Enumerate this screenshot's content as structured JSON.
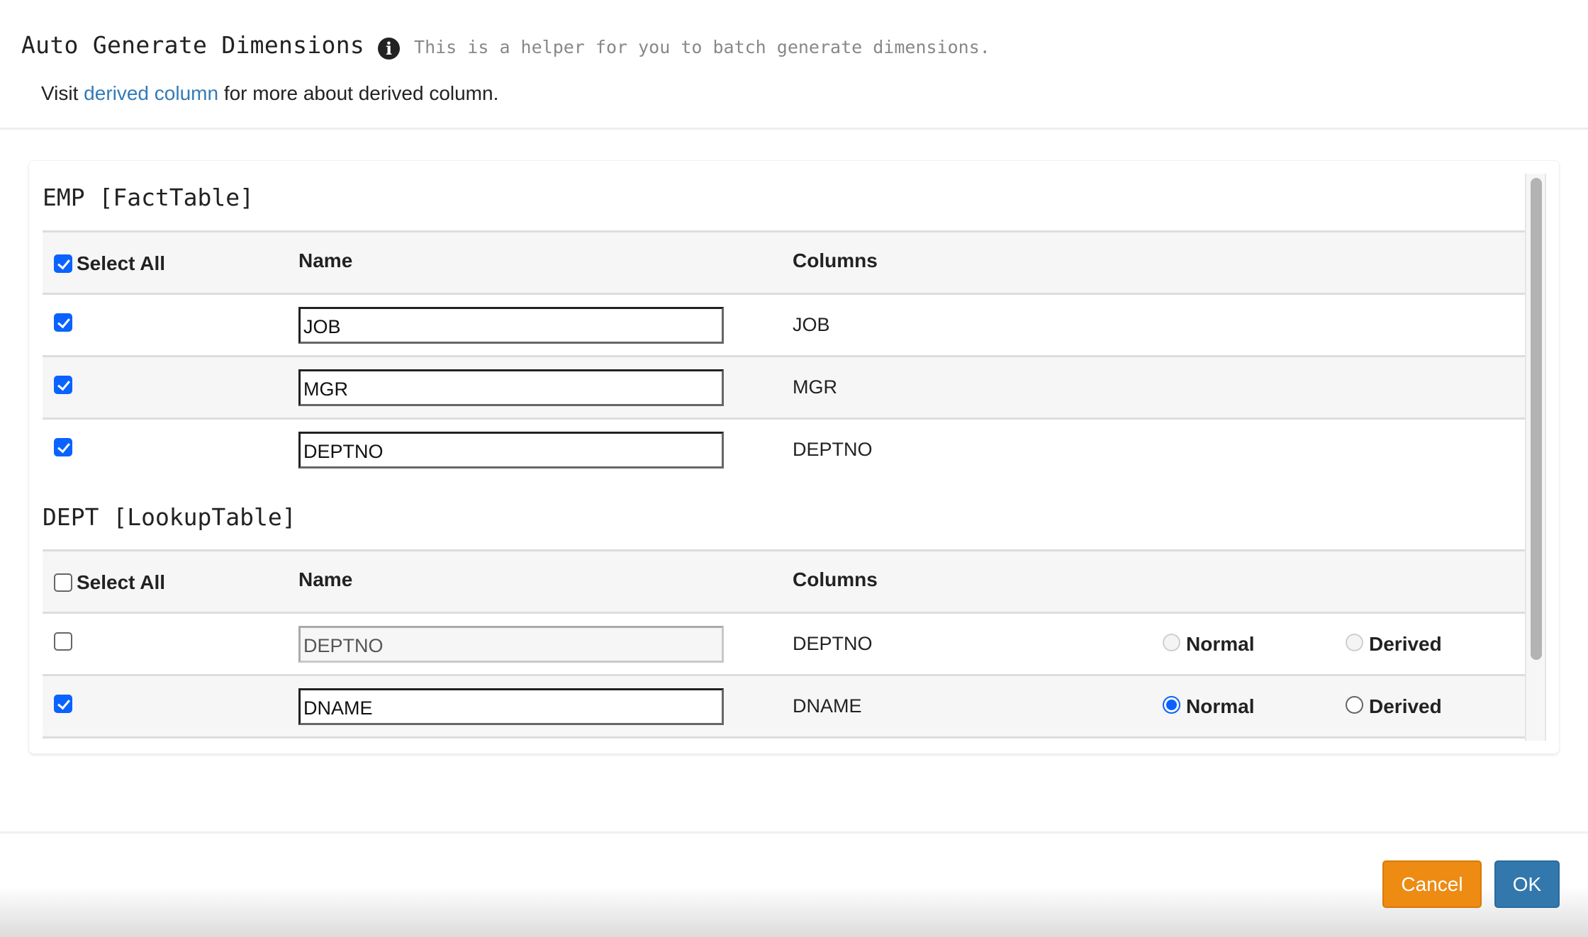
{
  "header": {
    "title": "Auto Generate Dimensions",
    "info_icon": "info-circle-icon",
    "subtitle": "This is a helper for you to batch generate dimensions.",
    "visit_prefix": "Visit",
    "visit_link": "derived column",
    "visit_suffix": "for more about derived column."
  },
  "columns_header": {
    "select_all": "Select All",
    "name": "Name",
    "columns": "Columns"
  },
  "tables": [
    {
      "title": "EMP [FactTable]",
      "select_all_checked": true,
      "rows": [
        {
          "checked": true,
          "name": "JOB",
          "column": "JOB"
        },
        {
          "checked": true,
          "name": "MGR",
          "column": "MGR"
        },
        {
          "checked": true,
          "name": "DEPTNO",
          "column": "DEPTNO"
        }
      ]
    },
    {
      "title": "DEPT [LookupTable]",
      "select_all_checked": false,
      "rows": [
        {
          "checked": false,
          "name": "DEPTNO",
          "column": "DEPTNO",
          "disabled": true,
          "type": "",
          "normal_label": "Normal",
          "derived_label": "Derived"
        },
        {
          "checked": true,
          "name": "DNAME",
          "column": "DNAME",
          "disabled": false,
          "type": "Normal",
          "normal_label": "Normal",
          "derived_label": "Derived"
        }
      ]
    }
  ],
  "footer": {
    "cancel_label": "Cancel",
    "ok_label": "OK"
  },
  "colors": {
    "link": "#337ab7",
    "checkbox_checked": "#0a62ff",
    "cancel_button": "#ed8b13",
    "ok_button": "#3278ad"
  }
}
